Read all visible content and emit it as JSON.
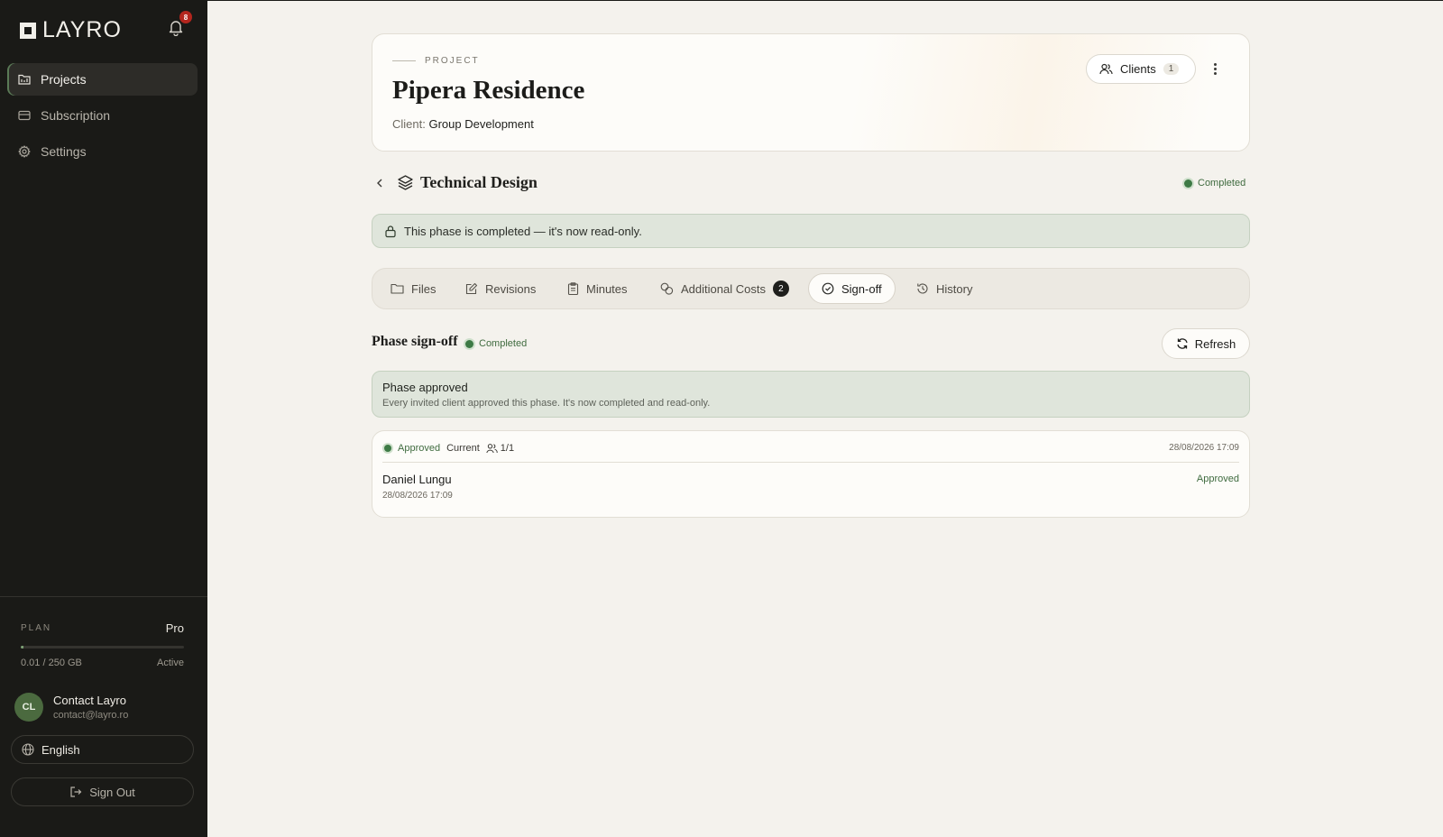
{
  "brand": {
    "name": "LAYRO"
  },
  "notifications": {
    "count": "8"
  },
  "sidebar": {
    "items": [
      {
        "label": "Projects",
        "icon": "folder-icon",
        "active": true
      },
      {
        "label": "Subscription",
        "icon": "card-icon",
        "active": false
      },
      {
        "label": "Settings",
        "icon": "gear-icon",
        "active": false
      }
    ],
    "plan": {
      "label": "PLAN",
      "value": "Pro",
      "usage": "0.01 / 250 GB",
      "usage_fraction": 4e-05,
      "status": "Active"
    },
    "user": {
      "initials": "CL",
      "name": "Contact Layro",
      "email": "contact@layro.ro"
    },
    "language": "English",
    "sign_out": "Sign Out"
  },
  "project": {
    "label": "PROJECT",
    "title": "Pipera Residence",
    "client_label": "Client:",
    "client_name": "Group Development",
    "clients_button": "Clients",
    "clients_count": "1"
  },
  "phase": {
    "title": "Technical Design",
    "status": "Completed",
    "readonly_message": "This phase is completed — it's now read-only."
  },
  "tabs": [
    {
      "label": "Files",
      "icon": "folder-icon"
    },
    {
      "label": "Revisions",
      "icon": "edit-icon"
    },
    {
      "label": "Minutes",
      "icon": "clipboard-icon"
    },
    {
      "label": "Additional Costs",
      "icon": "coins-icon",
      "badge": "2"
    },
    {
      "label": "Sign-off",
      "icon": "check-circle-icon",
      "active": true
    },
    {
      "label": "History",
      "icon": "history-icon"
    }
  ],
  "signoff": {
    "title": "Phase sign-off",
    "status": "Completed",
    "refresh": "Refresh",
    "banner_title": "Phase approved",
    "banner_text": "Every invited client approved this phase. It's now completed and read-only.",
    "record": {
      "status": "Approved",
      "tag": "Current",
      "count": "1/1",
      "date": "28/08/2026 17:09",
      "signer_name": "Daniel Lungu",
      "signer_date": "28/08/2026 17:09",
      "signer_status": "Approved"
    }
  },
  "colors": {
    "accent_green": "#3d7a45",
    "sidebar_bg": "#1a1a17",
    "page_bg": "#f4f2ed",
    "badge_red": "#b3261e"
  }
}
